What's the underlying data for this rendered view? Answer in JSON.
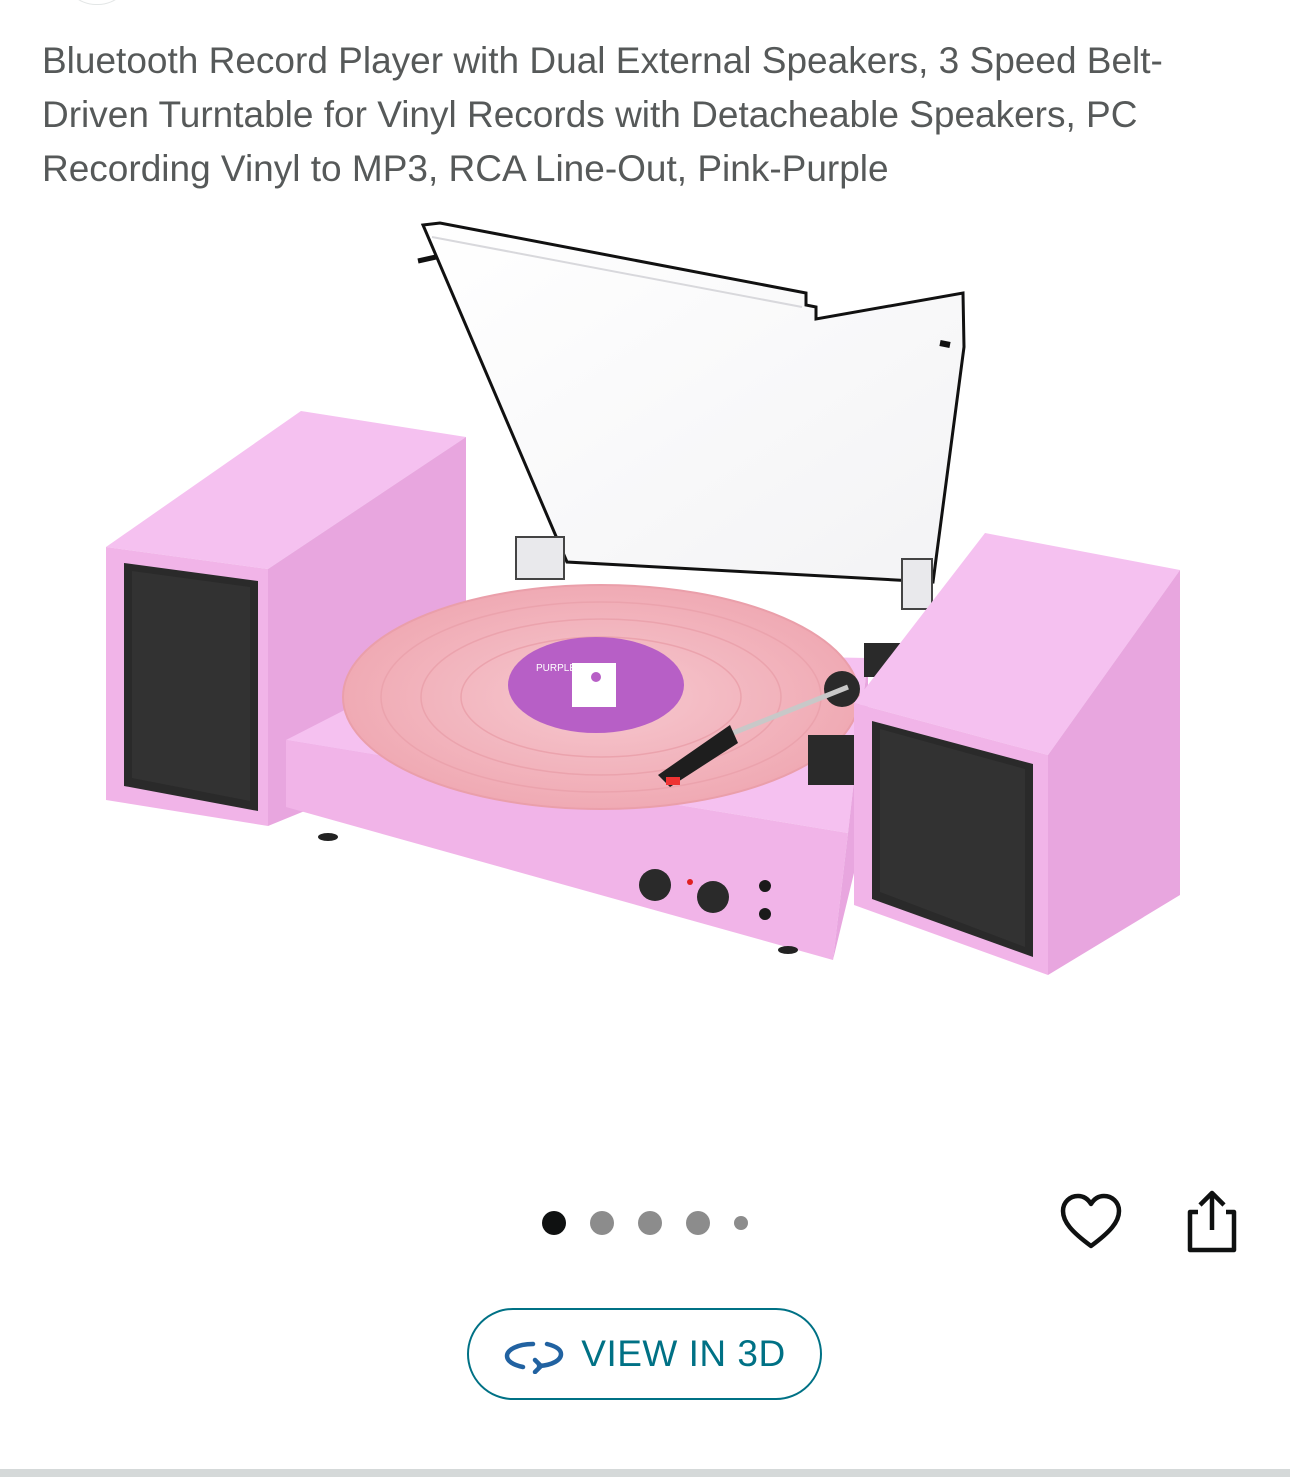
{
  "product": {
    "title": "Bluetooth Record Player with Dual External Speakers, 3 Speed Belt-Driven Turntable for Vinyl Records with Detacheable Speakers, PC Recording Vinyl to MP3, RCA Line-Out, Pink-Purple"
  },
  "gallery": {
    "image_subject": "pink turntable with two detached speakers and transparent dust cover",
    "record_label_text": "PURPLE",
    "dots": {
      "count": 5,
      "active_index": 0
    }
  },
  "actions": {
    "wishlist_icon": "heart-icon",
    "share_icon": "share-icon"
  },
  "view3d": {
    "label": "VIEW IN 3D",
    "icon": "rotate-3d-icon"
  },
  "colors": {
    "title_text": "#565959",
    "accent": "#007185",
    "dot_active": "#0f1111",
    "dot_inactive": "#8c8c8c",
    "product_pink": "#f1b4e8"
  }
}
